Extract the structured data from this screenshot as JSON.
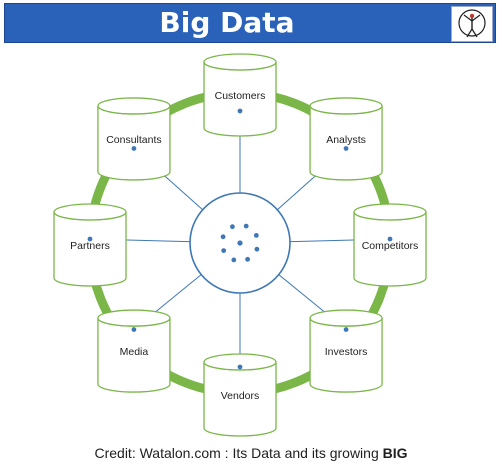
{
  "header": {
    "title": "Big Data",
    "logo_icon": "figure-in-circle-logo"
  },
  "diagram": {
    "hub_label": "",
    "nodes": [
      {
        "id": "customers",
        "label": "Customers"
      },
      {
        "id": "analysts",
        "label": "Analysts"
      },
      {
        "id": "competitors",
        "label": "Competitors"
      },
      {
        "id": "investors",
        "label": "Investors"
      },
      {
        "id": "vendors",
        "label": "Vendors"
      },
      {
        "id": "media",
        "label": "Media"
      },
      {
        "id": "partners",
        "label": "Partners"
      },
      {
        "id": "consultants",
        "label": "Consultants"
      }
    ],
    "colors": {
      "ring": "#7ab648",
      "cylinder_stroke": "#7ab648",
      "connector": "#3f78b5",
      "hub_stroke": "#3f78b5",
      "banner": "#2b62b9"
    }
  },
  "footer": {
    "credit_text": "Credit: Watalon.com : Its Data and its growing",
    "credit_bold": "BIG"
  }
}
